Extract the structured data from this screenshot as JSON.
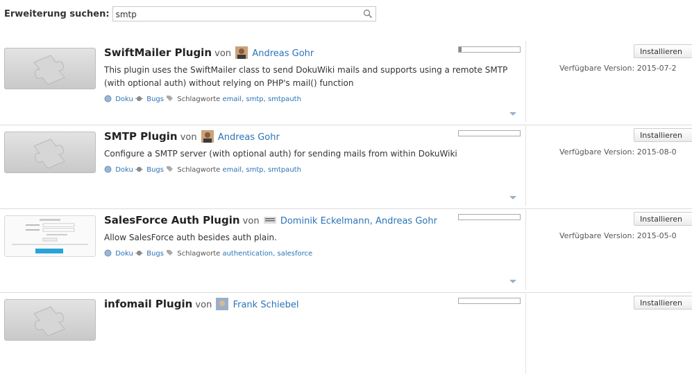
{
  "search": {
    "label": "Erweiterung suchen:",
    "value": "smtp"
  },
  "plugins": [
    {
      "title": "SwiftMailer Plugin",
      "by": "von",
      "author": "Andreas Gohr",
      "description": "This plugin uses the SwiftMailer class to send DokuWiki mails and supports using a remote SMTP (with optional auth) without relying on PHP's mail() function",
      "doku": "Doku",
      "bugs": "Bugs",
      "tags_label": "Schlagworte",
      "tags": "email, smtp, smtpauth",
      "popularity": 0.05,
      "install": "Installieren",
      "version": "Verfügbare Version: 2015-07-2"
    },
    {
      "title": "SMTP Plugin",
      "by": "von",
      "author": "Andreas Gohr",
      "description": "Configure a SMTP server (with optional auth) for sending mails from within DokuWiki",
      "doku": "Doku",
      "bugs": "Bugs",
      "tags_label": "Schlagworte",
      "tags": "email, smtp, smtpauth",
      "popularity": 0.0,
      "install": "Installieren",
      "version": "Verfügbare Version: 2015-08-0"
    },
    {
      "title": "SalesForce Auth Plugin",
      "by": "von",
      "author": "Dominik Eckelmann, Andreas Gohr",
      "description": "Allow SalesForce auth besides auth plain.",
      "doku": "Doku",
      "bugs": "Bugs",
      "tags_label": "Schlagworte",
      "tags": "authentication, salesforce",
      "popularity": 0.0,
      "install": "Installieren",
      "version": "Verfügbare Version: 2015-05-0"
    },
    {
      "title": "infomail Plugin",
      "by": "von",
      "author": "Frank Schiebel",
      "install": "Installieren",
      "popularity": 0.0
    }
  ]
}
